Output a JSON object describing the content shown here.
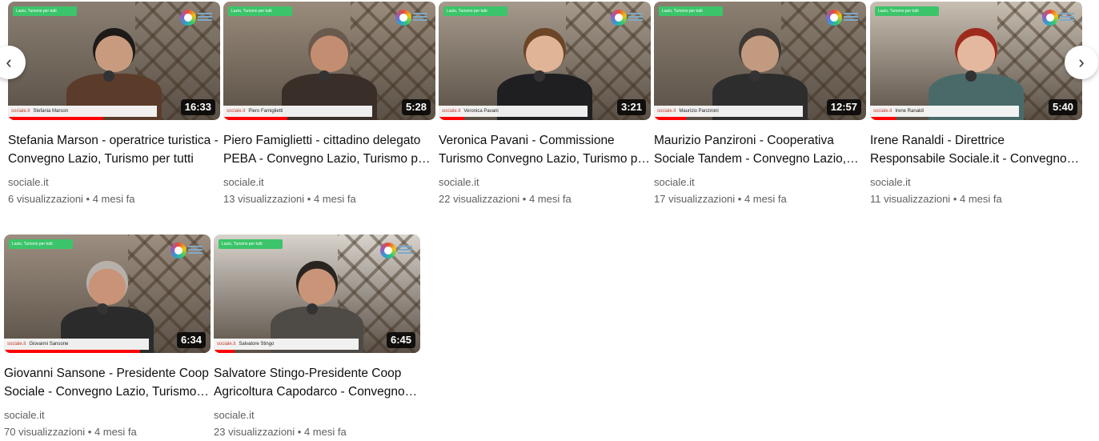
{
  "thumb_overlay": {
    "banner_text": "Lazio, Turismo per tutti",
    "brand_text": "sociale.it"
  },
  "videos": [
    {
      "title": "Stefania Marson - operatrice turistica - Convegno Lazio, Turismo per tutti",
      "channel": "sociale.it",
      "views": "6 visualizzazioni",
      "age": "4 mesi fa",
      "duration": "16:33",
      "lower_third": "Stefania Marson",
      "progress": 0.45,
      "bg": "#8a7f72",
      "skin": "#c99b7e",
      "hair": "#1e1a18",
      "shirt": "#5b3b2a"
    },
    {
      "title": "Piero Famiglietti - cittadino delegato PEBA - Convegno Lazio, Turismo per tutti",
      "channel": "sociale.it",
      "views": "13 visualizzazioni",
      "age": "4 mesi fa",
      "duration": "5:28",
      "lower_third": "Piero Famiglietti",
      "progress": 0.3,
      "bg": "#9a8c7c",
      "skin": "#c28d70",
      "hair": "#6a5a4d",
      "shirt": "#3a2e28"
    },
    {
      "title": "Veronica Pavani - Commissione Turismo Convegno Lazio, Turismo per tutti",
      "channel": "sociale.it",
      "views": "22 visualizzazioni",
      "age": "4 mesi fa",
      "duration": "3:21",
      "lower_third": "Veronica Pavani",
      "progress": 0.12,
      "bg": "#a59a8c",
      "skin": "#e0b497",
      "hair": "#6b4526",
      "shirt": "#1f1f22"
    },
    {
      "title": "Maurizio Panzironi - Cooperativa Sociale Tandem - Convegno Lazio, Turismo per tutti",
      "channel": "sociale.it",
      "views": "17 visualizzazioni",
      "age": "4 mesi fa",
      "duration": "12:57",
      "lower_third": "Maurizio Panzironi",
      "progress": 0.15,
      "bg": "#8b7f71",
      "skin": "#c29a7f",
      "hair": "#3d3833",
      "shirt": "#2d2d2d"
    },
    {
      "title": "Irene Ranaldi - Direttrice Responsabile Sociale.it - Convegno Lazio, Turismo per tutti",
      "channel": "sociale.it",
      "views": "11 visualizzazioni",
      "age": "4 mesi fa",
      "duration": "5:40",
      "lower_third": "Irene Ranaldi",
      "progress": 0.12,
      "bg": "#c8bfb2",
      "skin": "#e4b89f",
      "hair": "#9e2a1c",
      "shirt": "#4a6a6a"
    },
    {
      "title": "Giovanni Sansone - Presidente Coop Sociale - Convegno Lazio, Turismo per tutti",
      "channel": "sociale.it",
      "views": "70 visualizzazioni",
      "age": "4 mesi fa",
      "duration": "6:34",
      "lower_third": "Giovanni Sansone",
      "progress": 0.66,
      "bg": "#9c8e80",
      "skin": "#c99378",
      "hair": "#b6b1ab",
      "shirt": "#2b2b2b"
    },
    {
      "title": "Salvatore Stingo-Presidente Coop Agricoltura Capodarco - Convegno Lazio, Turismo per tutti",
      "channel": "sociale.it",
      "views": "23 visualizzazioni",
      "age": "4 mesi fa",
      "duration": "6:45",
      "lower_third": "Salvatore Stingo",
      "progress": 0.1,
      "bg": "#d8d3cc",
      "skin": "#c99477",
      "hair": "#2a2420",
      "shirt": "#4e4a46"
    }
  ],
  "nav": {
    "prev_glyph": "‹",
    "next_glyph": "›"
  }
}
